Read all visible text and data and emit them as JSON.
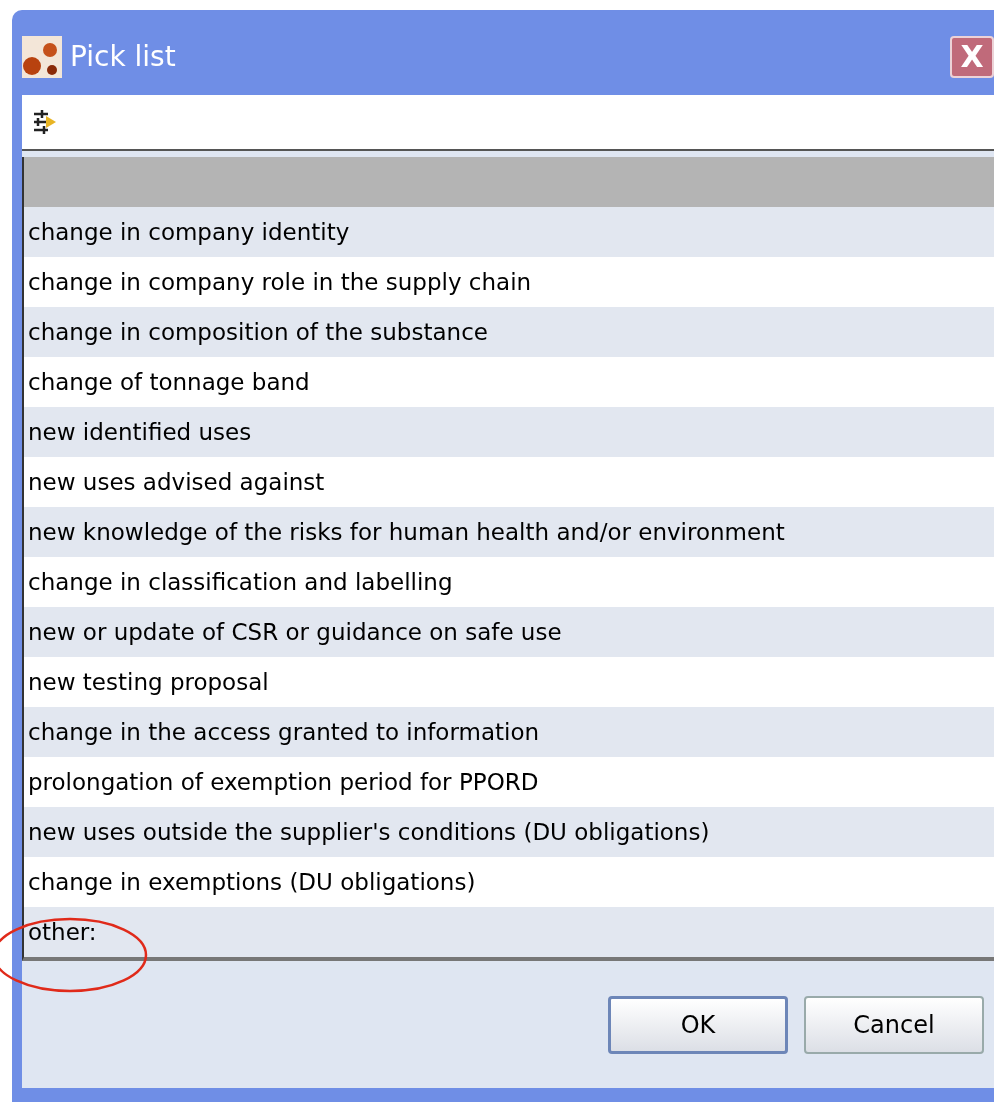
{
  "window": {
    "title": "Pick list",
    "close": "X"
  },
  "items": [
    {
      "selected": true
    },
    {
      "label": "change in company identity",
      "selected": false
    },
    {
      "label": "change in company role in the supply chain",
      "selected": false
    },
    {
      "label": "change in composition of the substance",
      "selected": false
    },
    {
      "label": "change of tonnage band",
      "selected": false
    },
    {
      "label": "new identified uses",
      "selected": false
    },
    {
      "label": "new uses advised against",
      "selected": false
    },
    {
      "label": "new knowledge of the risks for human health and/or environment",
      "selected": false
    },
    {
      "label": "change in classification and labelling",
      "selected": false
    },
    {
      "label": "new or update of CSR or guidance on safe use",
      "selected": false
    },
    {
      "label": "new testing proposal",
      "selected": false
    },
    {
      "label": "change in the access granted to information",
      "selected": false
    },
    {
      "label": "prolongation of exemption period for PPORD",
      "selected": false
    },
    {
      "label": "new uses outside the supplier's conditions (DU obligations)",
      "selected": false
    },
    {
      "label": "change in exemptions (DU obligations)",
      "selected": false
    },
    {
      "label": "other:",
      "selected": false,
      "annotated": true
    }
  ],
  "buttons": [
    {
      "label": "OK",
      "default": true
    },
    {
      "label": "Cancel",
      "default": false
    }
  ]
}
